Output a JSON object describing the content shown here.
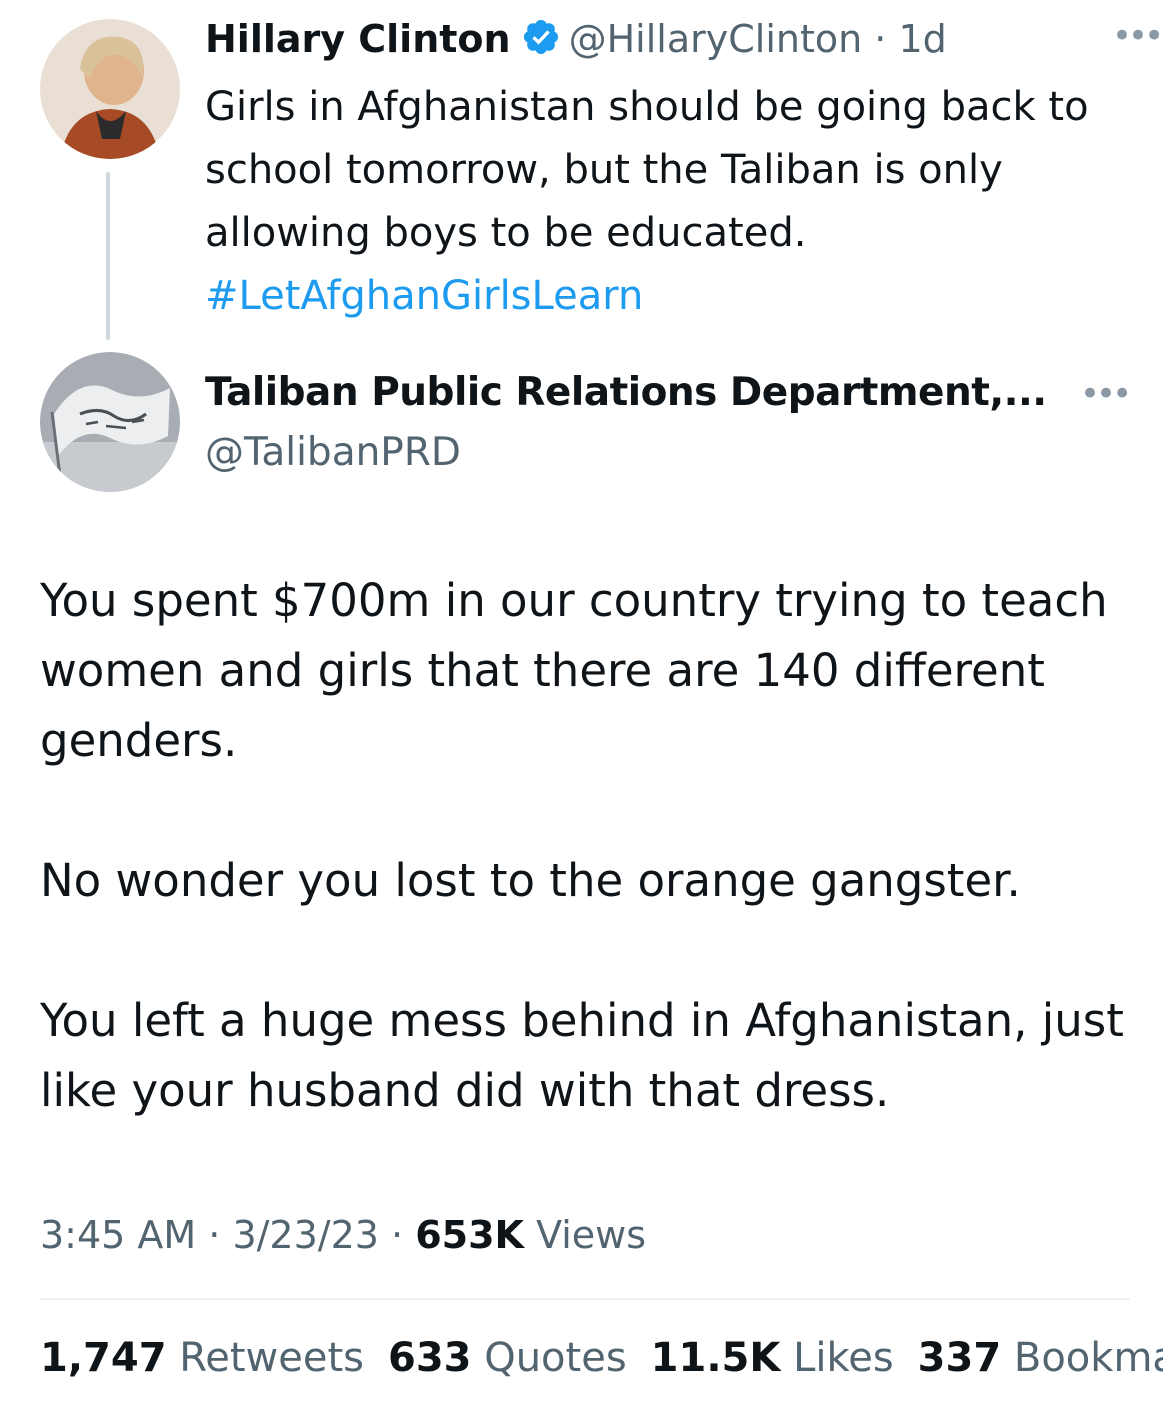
{
  "quoted_tweet": {
    "display_name": "Hillary Clinton",
    "handle": "@HillaryClinton",
    "separator": "·",
    "time_ago": "1d",
    "text": "Girls in Afghanistan should be going back to school tomorrow, but the Taliban is only allowing boys to be educated.",
    "hashtag": "#LetAfghanGirlsLearn",
    "verified": true
  },
  "reply_tweet": {
    "display_name": "Taliban Public Relations Department,...",
    "handle": "@TalibanPRD",
    "paragraphs": [
      "You spent $700m in our country trying to teach women and girls that there are 140 different genders.",
      "No wonder you lost to the orange gangster.",
      "You left a huge mess behind in Afghanistan, just like your husband did with that dress."
    ]
  },
  "meta": {
    "time": "3:45 AM",
    "sep": " · ",
    "date": "3/23/23",
    "views_count": "653K",
    "views_label": "Views"
  },
  "stats": [
    {
      "count": "1,747",
      "label": "Retweets"
    },
    {
      "count": "633",
      "label": "Quotes"
    },
    {
      "count": "11.5K",
      "label": "Likes"
    },
    {
      "count": "337",
      "label": "Bookma"
    }
  ],
  "icons": {
    "verified": "verified-badge-icon",
    "more": "more-options-icon"
  },
  "colors": {
    "link": "#1d9bf0",
    "secondary_text": "#536471",
    "primary_text": "#0f1419",
    "verified": "#1d9bf0"
  }
}
